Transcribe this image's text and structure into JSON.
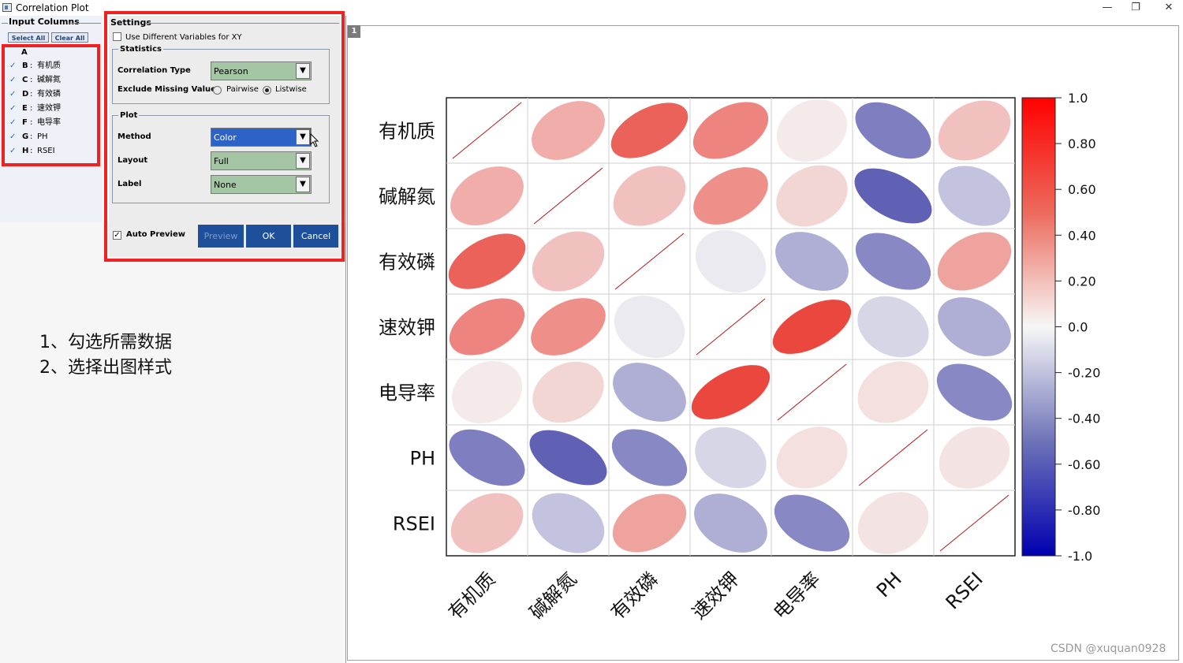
{
  "window": {
    "title": "Correlation Plot",
    "controls": [
      "—",
      "❐",
      "✕"
    ]
  },
  "input_columns": {
    "title": "Input Columns",
    "select_all": "Select All",
    "clear_all": "Clear All",
    "header": "A",
    "items": [
      {
        "check": "✓",
        "letter": "B",
        "sep": ":",
        "name": "有机质"
      },
      {
        "check": "✓",
        "letter": "C",
        "sep": ":",
        "name": "碱解氮"
      },
      {
        "check": "✓",
        "letter": "D",
        "sep": ":",
        "name": "有效磷"
      },
      {
        "check": "✓",
        "letter": "E",
        "sep": ":",
        "name": "速效钾"
      },
      {
        "check": "✓",
        "letter": "F",
        "sep": ":",
        "name": "电导率"
      },
      {
        "check": "✓",
        "letter": "G",
        "sep": ":",
        "name": "PH"
      },
      {
        "check": "✓",
        "letter": "H",
        "sep": ":",
        "name": "RSEI"
      }
    ]
  },
  "settings": {
    "title": "Settings",
    "use_different_xy": "Use Different Variables for XY",
    "statistics": {
      "title": "Statistics",
      "correlation_type_label": "Correlation Type",
      "correlation_type_value": "Pearson",
      "exclude_missing_label": "Exclude Missing Values",
      "pairwise": "Pairwise",
      "listwise": "Listwise"
    },
    "plot": {
      "title": "Plot",
      "method_label": "Method",
      "method_value": "Color",
      "layout_label": "Layout",
      "layout_value": "Full",
      "label_label": "Label",
      "label_value": "None"
    },
    "auto_preview": "Auto Preview",
    "preview_btn": "Preview",
    "ok_btn": "OK",
    "cancel_btn": "Cancel"
  },
  "annotations": [
    "1、勾选所需数据",
    "2、选择出图样式"
  ],
  "layer_badge": "1",
  "watermark": "CSDN @xuquan0928",
  "colors": {
    "positive": "#e8291f",
    "negative": "#2f2f9e",
    "neutral": "#f4f4f4",
    "highlight": "#ee2222"
  },
  "chart_data": {
    "type": "heatmap",
    "style": "ellipse correlation matrix",
    "variables": [
      "有机质",
      "碱解氮",
      "有效磷",
      "速效钾",
      "电导率",
      "PH",
      "RSEI"
    ],
    "matrix": [
      [
        1.0,
        0.35,
        0.72,
        0.55,
        0.05,
        -0.6,
        0.25
      ],
      [
        0.35,
        1.0,
        0.25,
        0.5,
        0.15,
        -0.75,
        -0.25
      ],
      [
        0.72,
        0.25,
        1.0,
        -0.05,
        -0.35,
        -0.55,
        0.4
      ],
      [
        0.55,
        0.5,
        -0.05,
        1.0,
        0.85,
        -0.15,
        -0.35
      ],
      [
        0.05,
        0.15,
        -0.35,
        0.85,
        1.0,
        0.1,
        -0.55
      ],
      [
        -0.6,
        -0.75,
        -0.55,
        -0.15,
        0.1,
        1.0,
        0.08
      ],
      [
        0.25,
        -0.25,
        0.4,
        -0.35,
        -0.55,
        0.08,
        1.0
      ]
    ],
    "colorbar": {
      "min": -1.0,
      "max": 1.0,
      "tick_labels": [
        "1.0",
        "0.80",
        "0.60",
        "0.40",
        "0.20",
        "0.0",
        "-0.20",
        "-0.40",
        "-0.60",
        "-0.80",
        "-1.0"
      ]
    },
    "grid": true
  }
}
